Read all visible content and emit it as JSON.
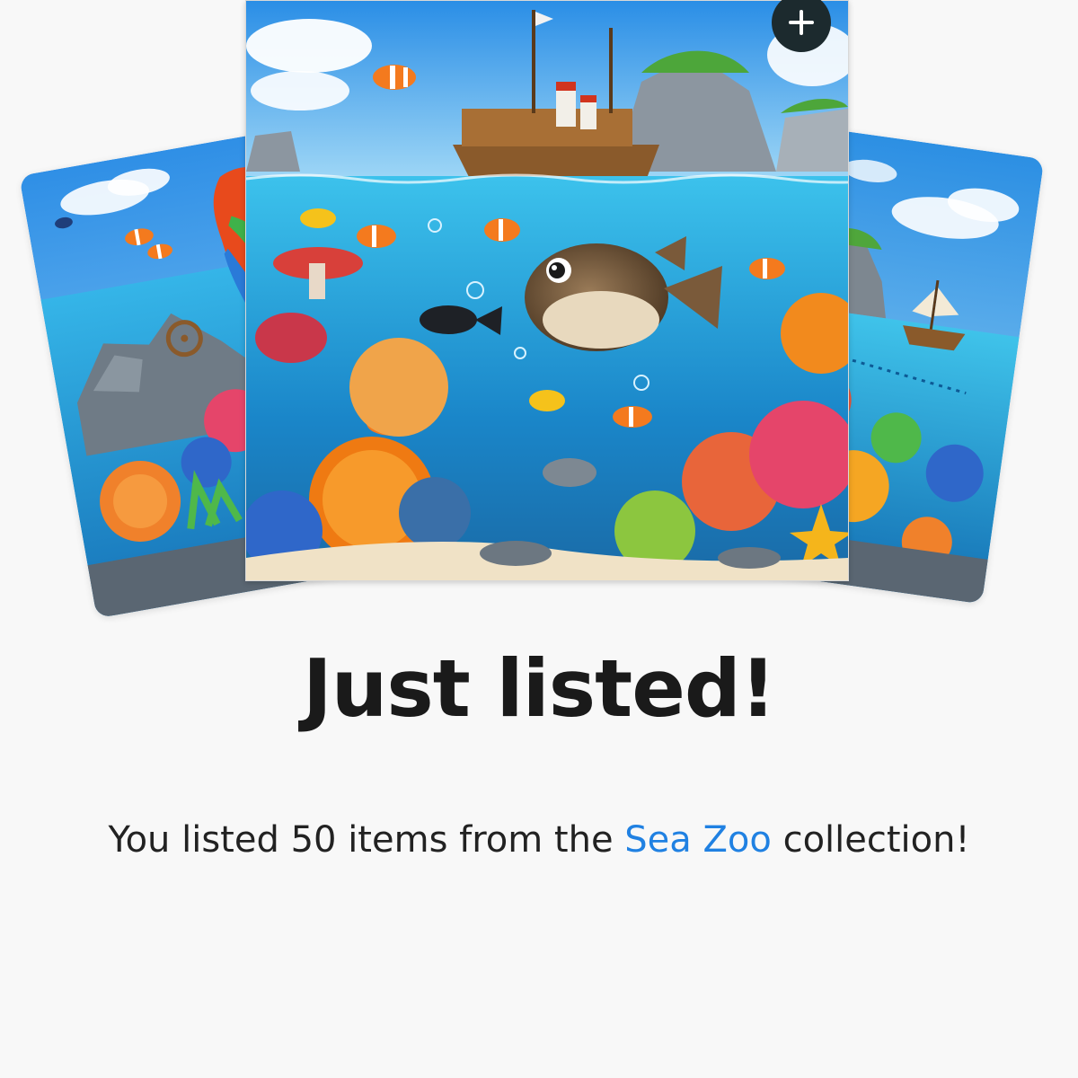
{
  "listing": {
    "title": "Just listed!",
    "message_prefix": "You listed 50 items from the ",
    "collection_name": "Sea Zoo",
    "message_suffix": " collection!"
  },
  "colors": {
    "link": "#2081e2",
    "add_button_bg": "#1c2a2e",
    "title_text": "#1a1a1a",
    "page_background": "#f8f8f8"
  },
  "icons": {
    "add": "plus-icon"
  },
  "cards": [
    {
      "position": "left",
      "depicts": "parrot on reef rocks with coral and clownfish"
    },
    {
      "position": "center",
      "depicts": "pufferfish under sea with wooden ship above water"
    },
    {
      "position": "right",
      "depicts": "sailing ship near rocky island over coral reef"
    }
  ]
}
